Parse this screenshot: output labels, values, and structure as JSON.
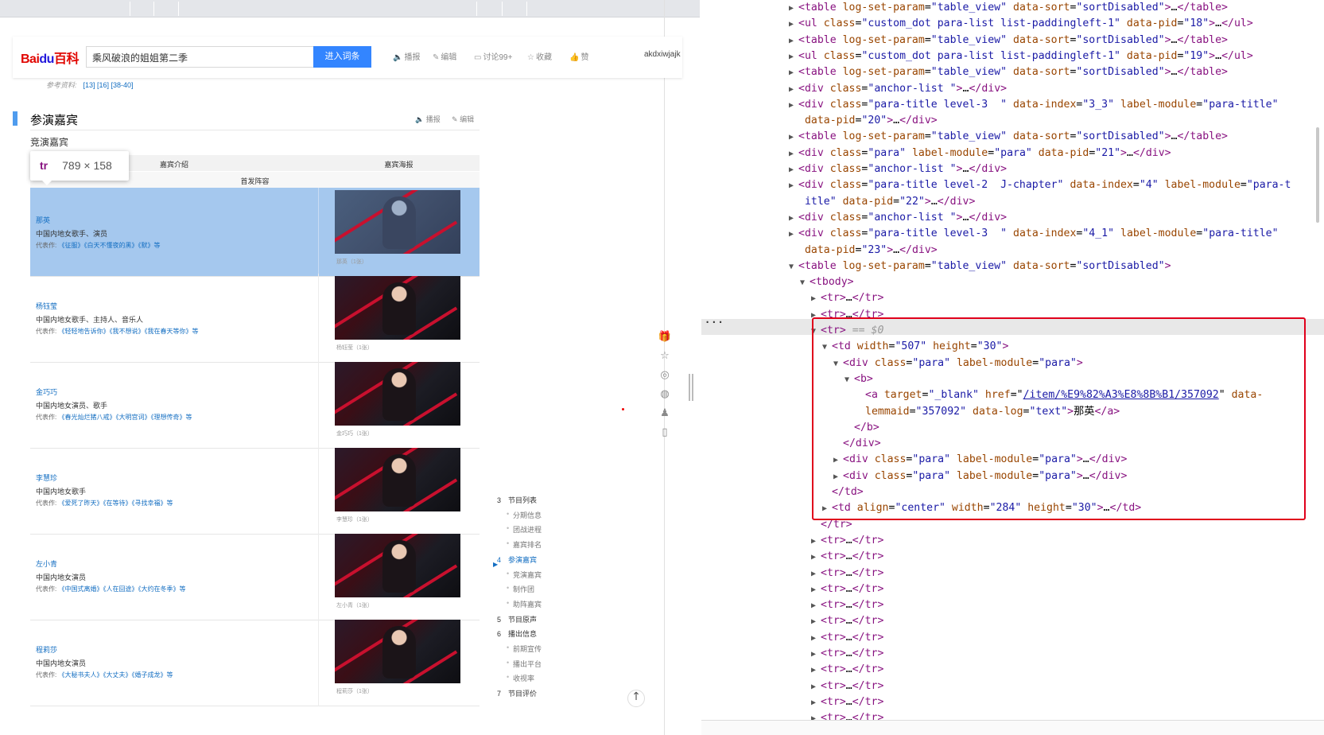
{
  "browser_page": {
    "logo": {
      "left": "Bai",
      "mid": "du",
      "right": "百科"
    },
    "search_value": "乘风破浪的姐姐第二季",
    "enter_button": "进入词条",
    "actions": {
      "play": "播报",
      "edit": "编辑",
      "discuss": "讨论99+",
      "collect": "收藏",
      "like": "赞"
    },
    "username": "akdxiwjajk",
    "references_label": "参考资料:",
    "references": "[13]  [16]  [38-40]",
    "section_title": "参演嘉宾",
    "section_actions": {
      "play": "播报",
      "edit": "编辑"
    },
    "sub_title": "竞演嘉宾",
    "tooltip": {
      "tag": "tr",
      "size": "789 × 158"
    },
    "table_header": {
      "col1": "嘉宾介绍",
      "col2": "嘉宾海报",
      "group": "首发阵容"
    },
    "guests": [
      {
        "name": "那英",
        "desc": "中国内地女歌手、演员",
        "works_label": "代表作:",
        "works": "《征服》《白天不懂夜的黑》《默》等",
        "caption": "那英（1张）"
      },
      {
        "name": "杨钰莹",
        "desc": "中国内地女歌手、主持人、音乐人",
        "works_label": "代表作:",
        "works": "《轻轻地告诉你》《我不想说》《我在春天等你》等",
        "caption": "杨钰莹（1张）"
      },
      {
        "name": "金巧巧",
        "desc": "中国内地女演员、歌手",
        "works_label": "代表作:",
        "works": "《春光灿烂猪八戒》《大明宫词》《理想传奇》等",
        "caption": "金巧巧（1张）"
      },
      {
        "name": "李慧珍",
        "desc": "中国内地女歌手",
        "works_label": "代表作:",
        "works": "《爱死了昨天》《在等待》《寻找幸福》等",
        "caption": "李慧珍（1张）"
      },
      {
        "name": "左小青",
        "desc": "中国内地女演员",
        "works_label": "代表作:",
        "works": "《中国式离婚》《人在囧途》《大约在冬季》等",
        "caption": "左小青（1张）"
      },
      {
        "name": "程莉莎",
        "desc": "中国内地女演员",
        "works_label": "代表作:",
        "works": "《大秘书夫人》《大丈夫》《婚子成龙》等",
        "caption": "程莉莎（1张）"
      }
    ],
    "toc": [
      {
        "num": "3",
        "label": "节目列表",
        "level": 1
      },
      {
        "label": "分期信息",
        "level": 2
      },
      {
        "label": "团战进程",
        "level": 2
      },
      {
        "label": "嘉宾排名",
        "level": 2
      },
      {
        "num": "4",
        "label": "参演嘉宾",
        "level": 1,
        "active": true
      },
      {
        "label": "竞演嘉宾",
        "level": 2
      },
      {
        "label": "制作团",
        "level": 2
      },
      {
        "label": "助阵嘉宾",
        "level": 2
      },
      {
        "num": "5",
        "label": "节目原声",
        "level": 1
      },
      {
        "num": "6",
        "label": "播出信息",
        "level": 1
      },
      {
        "label": "前期宣传",
        "level": 2
      },
      {
        "label": "播出平台",
        "level": 2
      },
      {
        "label": "收视率",
        "level": 2
      },
      {
        "num": "7",
        "label": "节目评价",
        "level": 1
      }
    ],
    "sidebar_icons": [
      "gift-icon",
      "star-icon",
      "weibo-icon",
      "wechat-icon",
      "qq-icon",
      "mobile-icon"
    ],
    "colors": {
      "accent": "#3385ff",
      "selected_row": "#a5c8ee",
      "link": "#136ec2",
      "logo_red": "#e10601",
      "logo_blue": "#2319dc"
    }
  },
  "devtools": {
    "selected_marker": "== $0",
    "href": "/item/%E9%82%A3%E8%8B%B1/357092",
    "guest_name": "那英",
    "colors": {
      "tag": "#881280",
      "attr_name": "#994500",
      "attr_value": "#1a1aa6",
      "highlight_box": "#e0001b"
    }
  }
}
